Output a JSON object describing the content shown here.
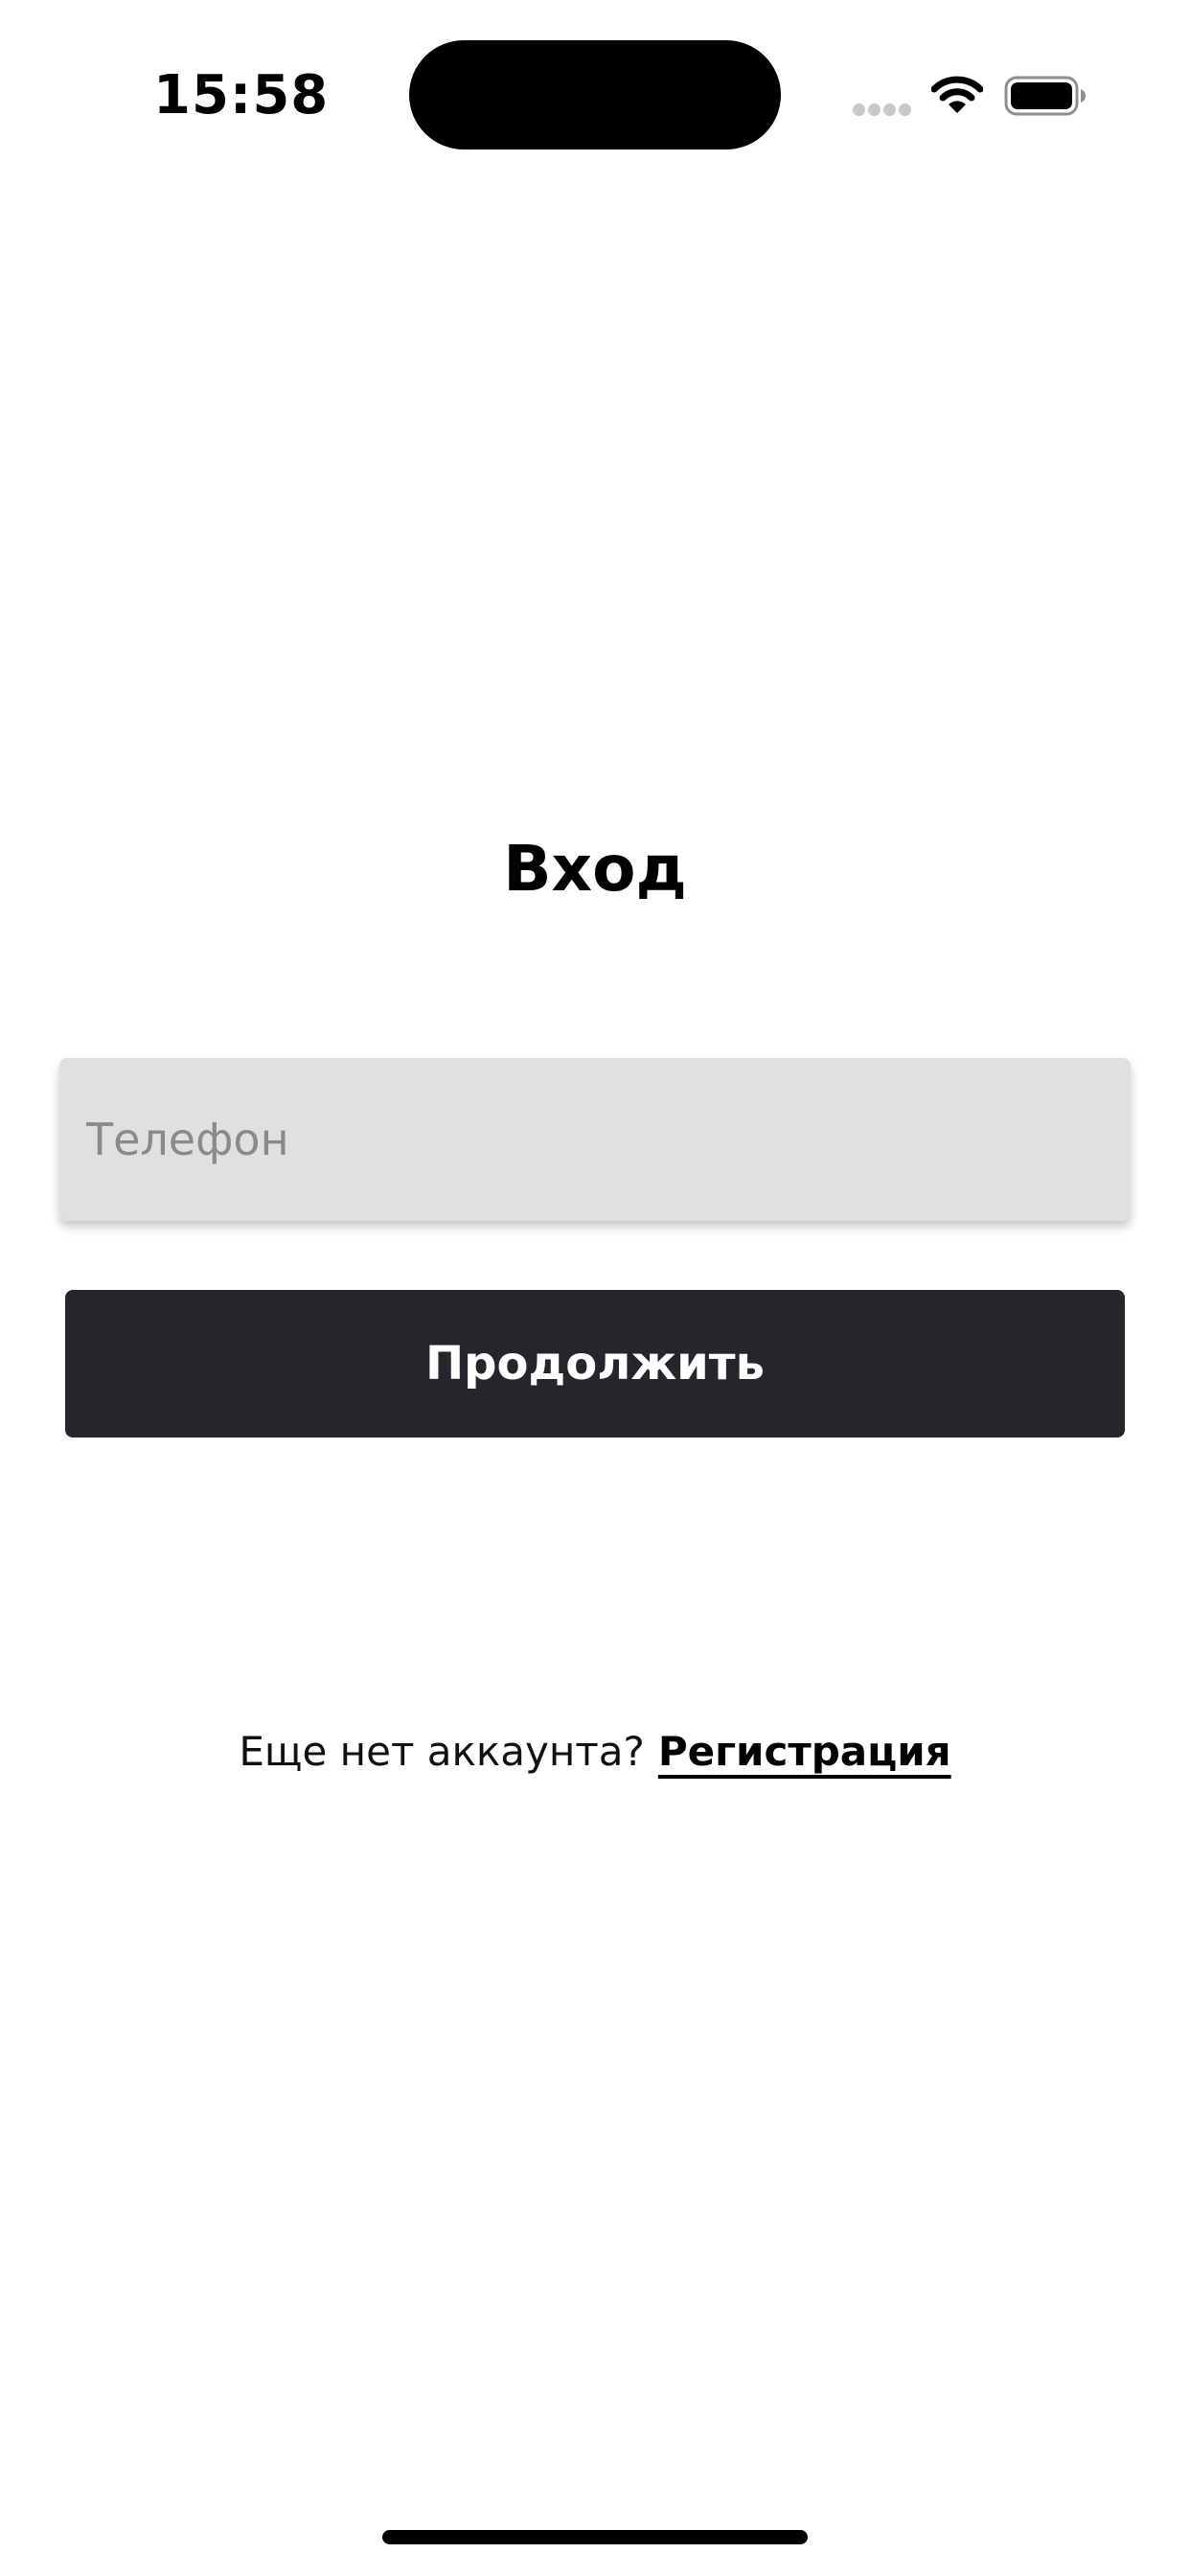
{
  "status_bar": {
    "time": "15:58"
  },
  "login": {
    "title": "Вход",
    "phone_placeholder": "Телефон",
    "phone_value": "",
    "continue_label": "Продолжить",
    "signup_prompt": "Еще нет аккаунта?",
    "signup_link": "Регистрация"
  },
  "colors": {
    "button_background": "#25262b",
    "input_background": "#e0e0e0",
    "placeholder": "#8a8a8a",
    "text": "#000000"
  },
  "icons": {
    "signal": "cellular-signal-icon",
    "wifi": "wifi-icon",
    "battery": "battery-icon"
  }
}
